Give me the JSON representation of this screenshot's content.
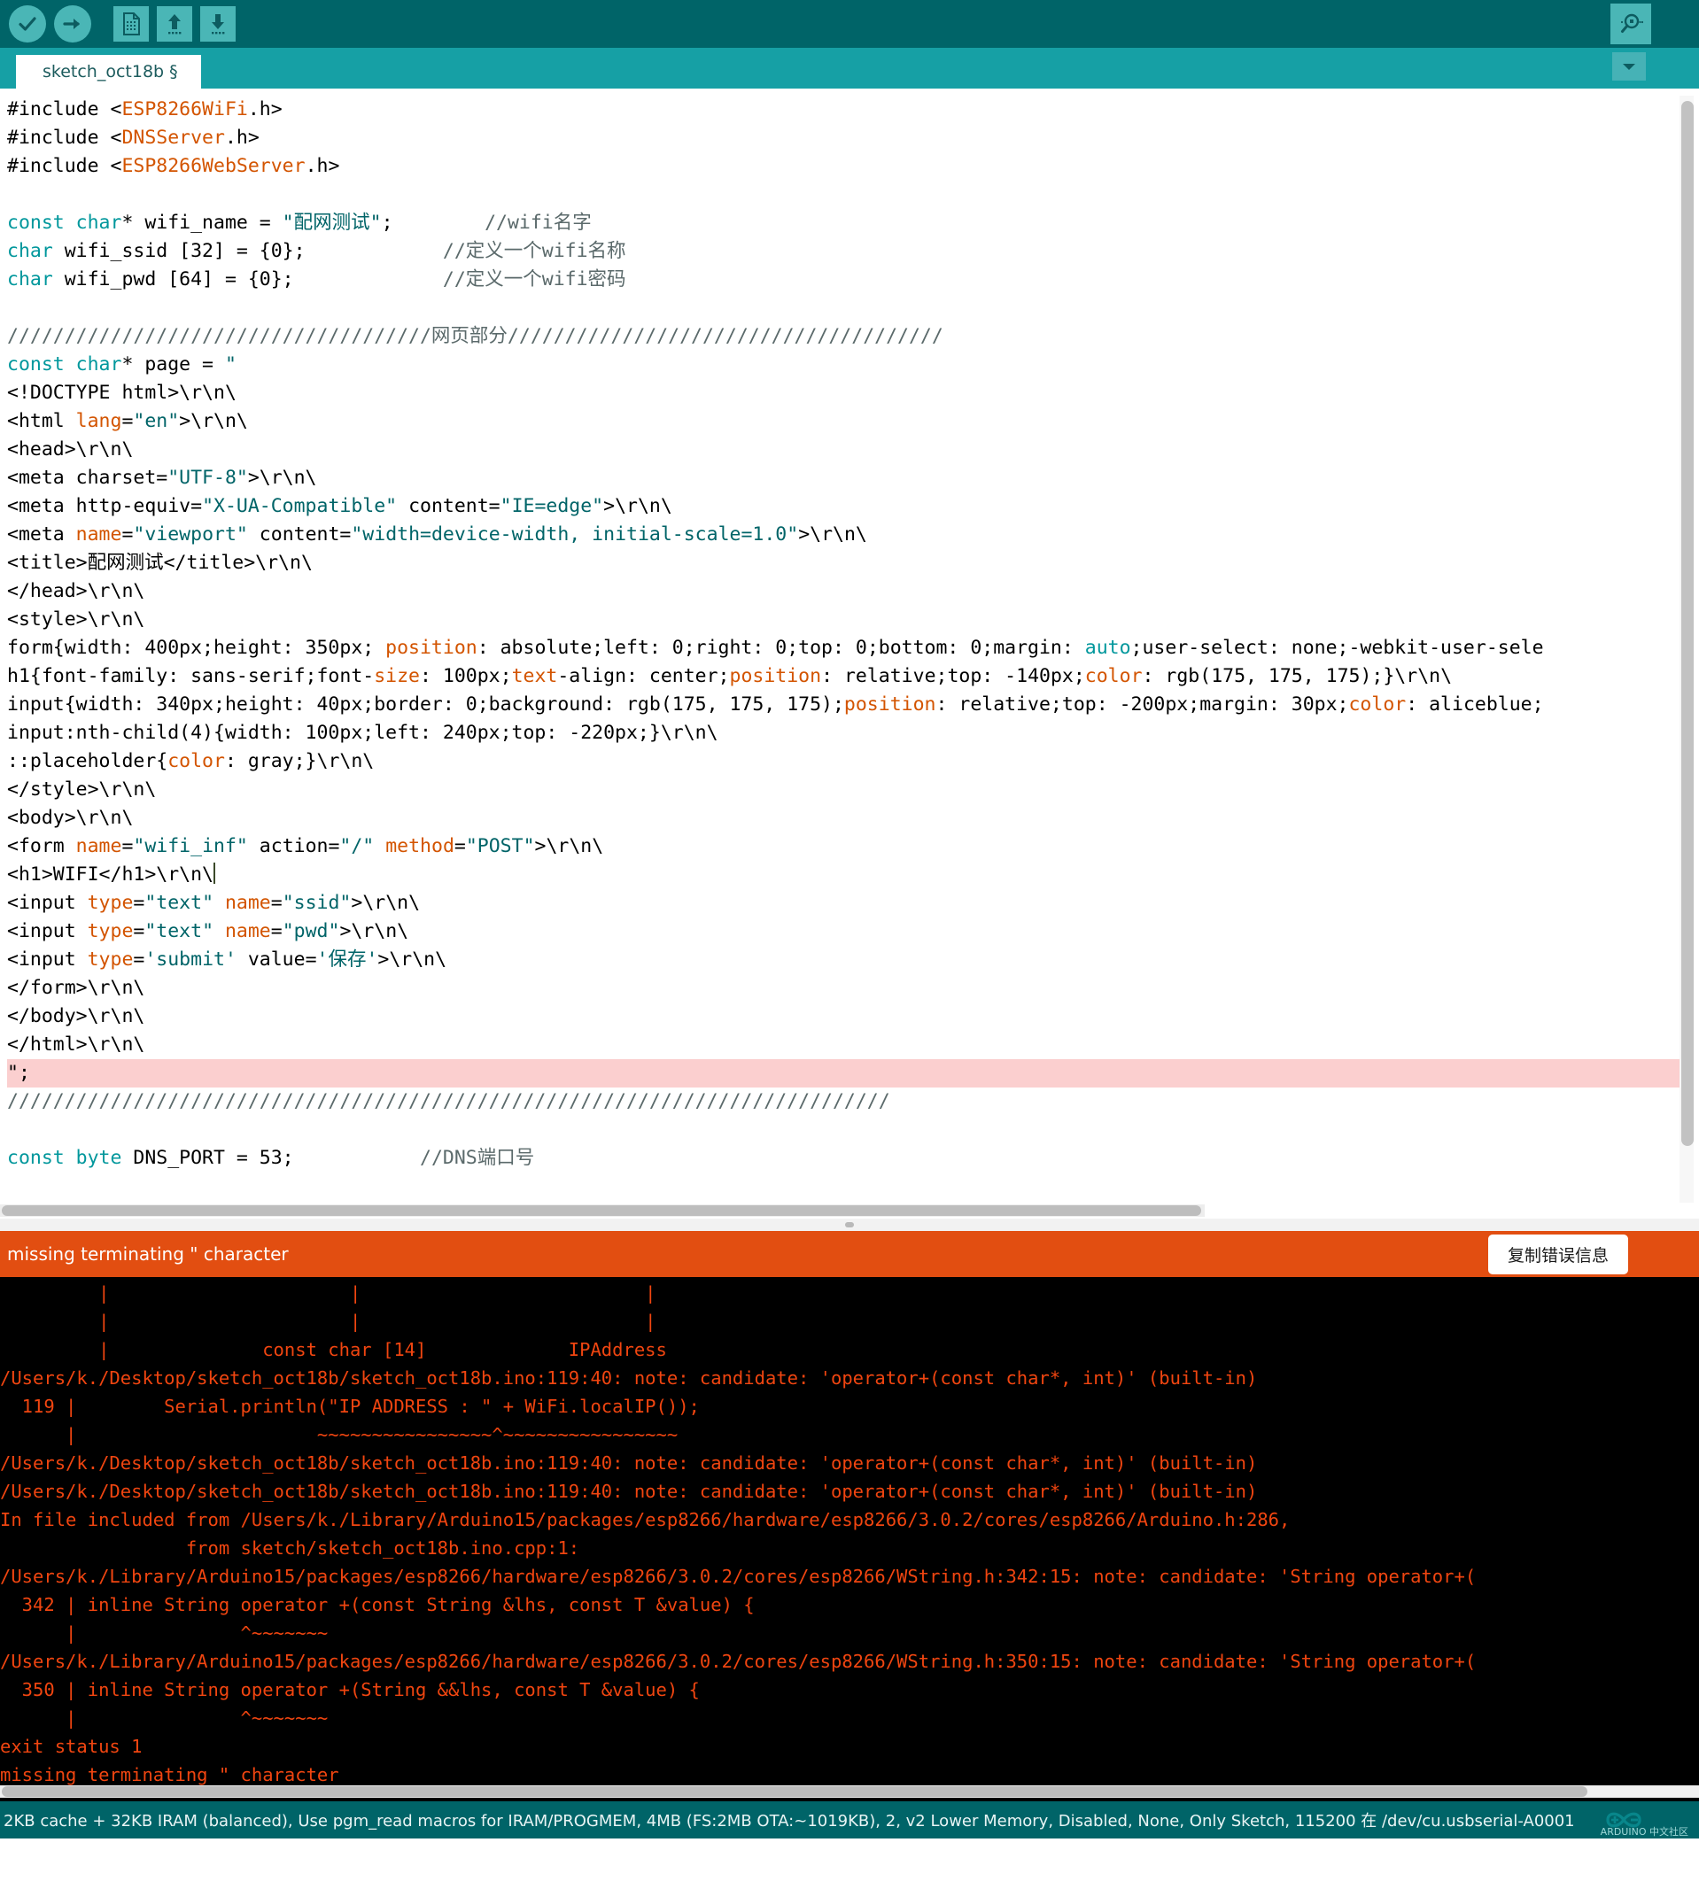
{
  "toolbar": {
    "verify_label": "Verify",
    "upload_label": "Upload",
    "new_label": "New",
    "open_label": "Open",
    "save_label": "Save",
    "serial_monitor_label": "Serial Monitor",
    "icons": [
      "check-icon",
      "arrow-right-icon",
      "new-file-icon",
      "upload-arrow-icon",
      "download-arrow-icon",
      "serial-monitor-icon"
    ]
  },
  "tabs": {
    "active_tab": "sketch_oct18b §",
    "dropdown_icon": "chevron-down-icon"
  },
  "editor": {
    "lines": [
      [
        {
          "t": "#include ",
          "c": "plain"
        },
        {
          "t": "<",
          "c": "plain"
        },
        {
          "t": "ESP8266WiFi",
          "c": "lib"
        },
        {
          "t": ".h>",
          "c": "plain"
        }
      ],
      [
        {
          "t": "#include ",
          "c": "plain"
        },
        {
          "t": "<",
          "c": "plain"
        },
        {
          "t": "DNSServer",
          "c": "lib"
        },
        {
          "t": ".h>",
          "c": "plain"
        }
      ],
      [
        {
          "t": "#include ",
          "c": "plain"
        },
        {
          "t": "<",
          "c": "plain"
        },
        {
          "t": "ESP8266WebServer",
          "c": "lib"
        },
        {
          "t": ".h>",
          "c": "plain"
        }
      ],
      [],
      [
        {
          "t": "const char",
          "c": "kw"
        },
        {
          "t": "* wifi_name = ",
          "c": "plain"
        },
        {
          "t": "\"配网测试\"",
          "c": "str"
        },
        {
          "t": ";        ",
          "c": "plain"
        },
        {
          "t": "//wifi名字",
          "c": "cm"
        }
      ],
      [
        {
          "t": "char",
          "c": "kw"
        },
        {
          "t": " wifi_ssid [32] = {0};            ",
          "c": "plain"
        },
        {
          "t": "//定义一个wifi名称",
          "c": "cm"
        }
      ],
      [
        {
          "t": "char",
          "c": "kw"
        },
        {
          "t": " wifi_pwd [64] = {0};             ",
          "c": "plain"
        },
        {
          "t": "//定义一个wifi密码",
          "c": "cm"
        }
      ],
      [],
      [
        {
          "t": "/////////////////////////////////////网页部分//////////////////////////////////////",
          "c": "cm"
        }
      ],
      [
        {
          "t": "const char",
          "c": "kw"
        },
        {
          "t": "* page = ",
          "c": "plain"
        },
        {
          "t": "\"",
          "c": "str"
        }
      ],
      [
        {
          "t": "<!DOCTYPE html>\\r\\n\\",
          "c": "plain"
        }
      ],
      [
        {
          "t": "<html ",
          "c": "plain"
        },
        {
          "t": "lang",
          "c": "attr"
        },
        {
          "t": "=",
          "c": "plain"
        },
        {
          "t": "\"en\"",
          "c": "str"
        },
        {
          "t": ">\\r\\n\\",
          "c": "plain"
        }
      ],
      [
        {
          "t": "<head>\\r\\n\\",
          "c": "plain"
        }
      ],
      [
        {
          "t": "<meta charset=",
          "c": "plain"
        },
        {
          "t": "\"UTF-8\"",
          "c": "str"
        },
        {
          "t": ">\\r\\n\\",
          "c": "plain"
        }
      ],
      [
        {
          "t": "<meta http-equiv=",
          "c": "plain"
        },
        {
          "t": "\"X-UA-Compatible\"",
          "c": "str"
        },
        {
          "t": " content=",
          "c": "plain"
        },
        {
          "t": "\"IE=edge\"",
          "c": "str"
        },
        {
          "t": ">\\r\\n\\",
          "c": "plain"
        }
      ],
      [
        {
          "t": "<meta ",
          "c": "plain"
        },
        {
          "t": "name",
          "c": "attr"
        },
        {
          "t": "=",
          "c": "plain"
        },
        {
          "t": "\"viewport\"",
          "c": "str"
        },
        {
          "t": " content=",
          "c": "plain"
        },
        {
          "t": "\"width=device-width, initial-scale=1.0\"",
          "c": "str"
        },
        {
          "t": ">\\r\\n\\",
          "c": "plain"
        }
      ],
      [
        {
          "t": "<title>配网测试</title>\\r\\n\\",
          "c": "plain"
        }
      ],
      [
        {
          "t": "</head>\\r\\n\\",
          "c": "plain"
        }
      ],
      [
        {
          "t": "<style>\\r\\n\\",
          "c": "plain"
        }
      ],
      [
        {
          "t": "form{width: 400px;height: 350px; ",
          "c": "plain"
        },
        {
          "t": "position",
          "c": "attr"
        },
        {
          "t": ": absolute;left: 0;right: 0;top: 0;bottom: 0;margin: ",
          "c": "plain"
        },
        {
          "t": "auto",
          "c": "kw"
        },
        {
          "t": ";user-select: none;-webkit-user-sele",
          "c": "plain"
        }
      ],
      [
        {
          "t": "h1{font-family: sans-serif;font-",
          "c": "plain"
        },
        {
          "t": "size",
          "c": "attr"
        },
        {
          "t": ": 100px;",
          "c": "plain"
        },
        {
          "t": "text",
          "c": "attr"
        },
        {
          "t": "-align: center;",
          "c": "plain"
        },
        {
          "t": "position",
          "c": "attr"
        },
        {
          "t": ": relative;top: -140px;",
          "c": "plain"
        },
        {
          "t": "color",
          "c": "attr"
        },
        {
          "t": ": rgb(175, 175, 175);}\\r\\n\\",
          "c": "plain"
        }
      ],
      [
        {
          "t": "input{width: 340px;height: 40px;border: 0;background: rgb(175, 175, 175);",
          "c": "plain"
        },
        {
          "t": "position",
          "c": "attr"
        },
        {
          "t": ": relative;top: -200px;margin: 30px;",
          "c": "plain"
        },
        {
          "t": "color",
          "c": "attr"
        },
        {
          "t": ": aliceblue;",
          "c": "plain"
        }
      ],
      [
        {
          "t": "input:nth-child(4){width: 100px;left: 240px;top: -220px;}\\r\\n\\",
          "c": "plain"
        }
      ],
      [
        {
          "t": "::placeholder{",
          "c": "plain"
        },
        {
          "t": "color",
          "c": "attr"
        },
        {
          "t": ": gray;}\\r\\n\\",
          "c": "plain"
        }
      ],
      [
        {
          "t": "</style>\\r\\n\\",
          "c": "plain"
        }
      ],
      [
        {
          "t": "<body>\\r\\n\\",
          "c": "plain"
        }
      ],
      [
        {
          "t": "<form ",
          "c": "plain"
        },
        {
          "t": "name",
          "c": "attr"
        },
        {
          "t": "=",
          "c": "plain"
        },
        {
          "t": "\"wifi_inf\"",
          "c": "str"
        },
        {
          "t": " action=",
          "c": "plain"
        },
        {
          "t": "\"/\"",
          "c": "str"
        },
        {
          "t": " ",
          "c": "plain"
        },
        {
          "t": "method",
          "c": "attr"
        },
        {
          "t": "=",
          "c": "plain"
        },
        {
          "t": "\"POST\"",
          "c": "str"
        },
        {
          "t": ">\\r\\n\\",
          "c": "plain"
        }
      ],
      [
        {
          "t": "<h1>WIFI</h1>\\r\\n\\",
          "c": "plain"
        },
        {
          "t": "",
          "c": "cursor"
        }
      ],
      [
        {
          "t": "<input ",
          "c": "plain"
        },
        {
          "t": "type",
          "c": "attr"
        },
        {
          "t": "=",
          "c": "plain"
        },
        {
          "t": "\"text\"",
          "c": "str"
        },
        {
          "t": " ",
          "c": "plain"
        },
        {
          "t": "name",
          "c": "attr"
        },
        {
          "t": "=",
          "c": "plain"
        },
        {
          "t": "\"ssid\"",
          "c": "str"
        },
        {
          "t": ">\\r\\n\\",
          "c": "plain"
        }
      ],
      [
        {
          "t": "<input ",
          "c": "plain"
        },
        {
          "t": "type",
          "c": "attr"
        },
        {
          "t": "=",
          "c": "plain"
        },
        {
          "t": "\"text\"",
          "c": "str"
        },
        {
          "t": " ",
          "c": "plain"
        },
        {
          "t": "name",
          "c": "attr"
        },
        {
          "t": "=",
          "c": "plain"
        },
        {
          "t": "\"pwd\"",
          "c": "str"
        },
        {
          "t": ">\\r\\n\\",
          "c": "plain"
        }
      ],
      [
        {
          "t": "<input ",
          "c": "plain"
        },
        {
          "t": "type",
          "c": "attr"
        },
        {
          "t": "=",
          "c": "plain"
        },
        {
          "t": "'submit'",
          "c": "str"
        },
        {
          "t": " value=",
          "c": "plain"
        },
        {
          "t": "'保存'",
          "c": "str"
        },
        {
          "t": ">\\r\\n\\",
          "c": "plain"
        }
      ],
      [
        {
          "t": "</form>\\r\\n\\",
          "c": "plain"
        }
      ],
      [
        {
          "t": "</body>\\r\\n\\",
          "c": "plain"
        }
      ],
      [
        {
          "t": "</html>\\r\\n\\",
          "c": "plain"
        }
      ],
      [
        {
          "t": "\";",
          "c": "plain",
          "err": true
        }
      ],
      [
        {
          "t": "/////////////////////////////////////////////////////////////////////////////",
          "c": "cm"
        }
      ],
      [],
      [
        {
          "t": "const byte",
          "c": "kw"
        },
        {
          "t": " DNS_PORT = 53;           ",
          "c": "plain"
        },
        {
          "t": "//DNS端口号",
          "c": "cm"
        }
      ]
    ]
  },
  "error_bar": {
    "message": "missing terminating \" character",
    "copy_button": "复制错误信息"
  },
  "console": {
    "text": "         |                      |                          |\n         |                      |                          |\n         |              const char [14]             IPAddress\n/Users/k./Desktop/sketch_oct18b/sketch_oct18b.ino:119:40: note: candidate: 'operator+(const char*, int)' (built-in)\n  119 |        Serial.println(\"IP ADDRESS : \" + WiFi.localIP());\n      |                      ~~~~~~~~~~~~~~~~^~~~~~~~~~~~~~~~~\n/Users/k./Desktop/sketch_oct18b/sketch_oct18b.ino:119:40: note: candidate: 'operator+(const char*, int)' (built-in)\n/Users/k./Desktop/sketch_oct18b/sketch_oct18b.ino:119:40: note: candidate: 'operator+(const char*, int)' (built-in)\nIn file included from /Users/k./Library/Arduino15/packages/esp8266/hardware/esp8266/3.0.2/cores/esp8266/Arduino.h:286,\n                 from sketch/sketch_oct18b.ino.cpp:1:\n/Users/k./Library/Arduino15/packages/esp8266/hardware/esp8266/3.0.2/cores/esp8266/WString.h:342:15: note: candidate: 'String operator+(\n  342 | inline String operator +(const String &lhs, const T &value) {\n      |               ^~~~~~~~\n/Users/k./Library/Arduino15/packages/esp8266/hardware/esp8266/3.0.2/cores/esp8266/WString.h:350:15: note: candidate: 'String operator+(\n  350 | inline String operator +(String &&lhs, const T &value) {\n      |               ^~~~~~~~\nexit status 1\nmissing terminating \" character"
  },
  "status_bar": {
    "text": "2KB cache + 32KB IRAM (balanced), Use pgm_read macros for IRAM/PROGMEM, 4MB (FS:2MB OTA:~1019KB), 2, v2 Lower Memory, Disabled, None, Only Sketch, 115200 在 /dev/cu.usbserial-A0001",
    "watermark": "ARDUINO 中文社区"
  },
  "colors": {
    "toolbar_bg": "#006468",
    "tabbar_bg": "#16a0a5",
    "button_bg": "#4ab6b6",
    "error_bar": "#e24e11",
    "console_bg": "#000000",
    "console_fg": "#f04510",
    "keyword": "#00979c",
    "library": "#d35400",
    "comment": "#5b6a6b",
    "string": "#006468",
    "error_highlight": "#fbcfcf"
  }
}
